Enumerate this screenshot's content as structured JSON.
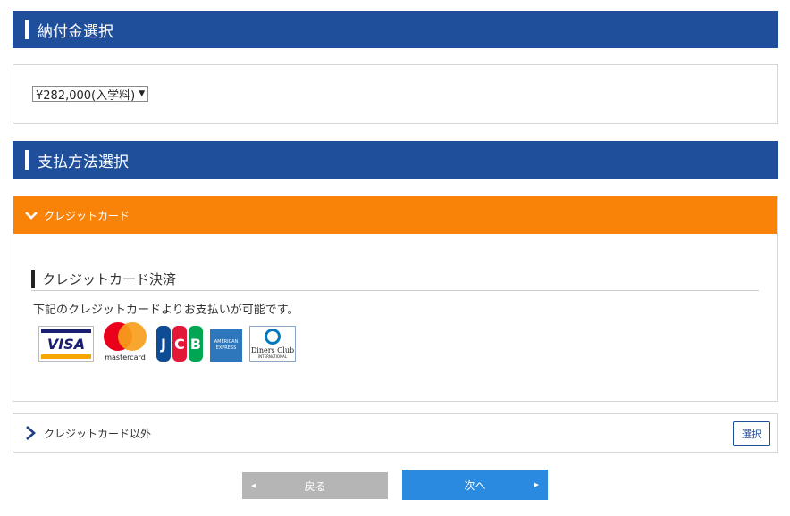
{
  "payment_section": {
    "title": "納付金選択"
  },
  "fee_select": {
    "selected": "¥282,000(入学料)"
  },
  "method_section": {
    "title": "支払方法選択"
  },
  "credit_accordion": {
    "label": "クレジットカード",
    "subtitle": "クレジットカード決済",
    "description": "下記のクレジットカードよりお支払いが可能です。",
    "logos": {
      "visa": "VISA",
      "mastercard": "mastercard",
      "jcb": [
        "J",
        "C",
        "B"
      ],
      "amex_top": "AMERICAN",
      "amex_bottom": "EXPRESS",
      "diners_name": "Diners Club",
      "diners_sub": "INTERNATIONAL"
    }
  },
  "other_accordion": {
    "label": "クレジットカード以外",
    "select_label": "選択"
  },
  "nav": {
    "back_label": "戻る",
    "next_label": "次へ"
  },
  "colors": {
    "header_blue": "#1f4e9a",
    "accordion_orange": "#f98309",
    "next_blue": "#2a8ae0",
    "back_gray": "#b5b5b5"
  },
  "icons": {
    "open_accordion": "chevron-down-icon",
    "closed_accordion": "chevron-right-icon"
  }
}
